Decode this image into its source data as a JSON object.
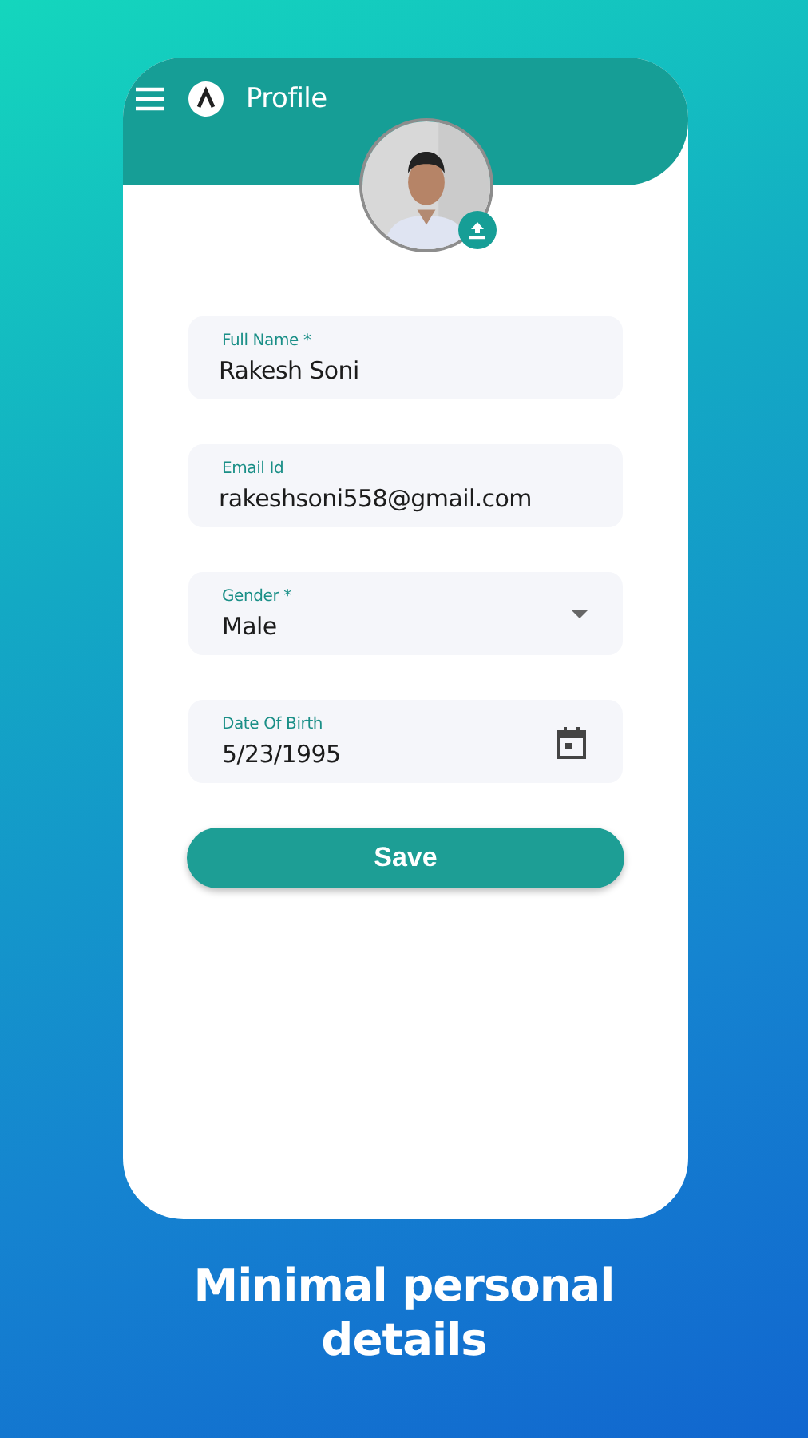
{
  "app_bar": {
    "title": "Profile"
  },
  "form": {
    "fields": [
      {
        "kind": "text",
        "label": "Full Name *",
        "value": "Rakesh Soni"
      },
      {
        "kind": "text",
        "label": "Email Id",
        "value": "rakeshsoni558@gmail.com"
      },
      {
        "kind": "select",
        "label": "Gender *",
        "value": "Male"
      },
      {
        "kind": "date",
        "label": "Date Of Birth",
        "value": "5/23/1995"
      }
    ]
  },
  "save_button": {
    "label": "Save"
  },
  "caption": "Minimal personal details"
}
